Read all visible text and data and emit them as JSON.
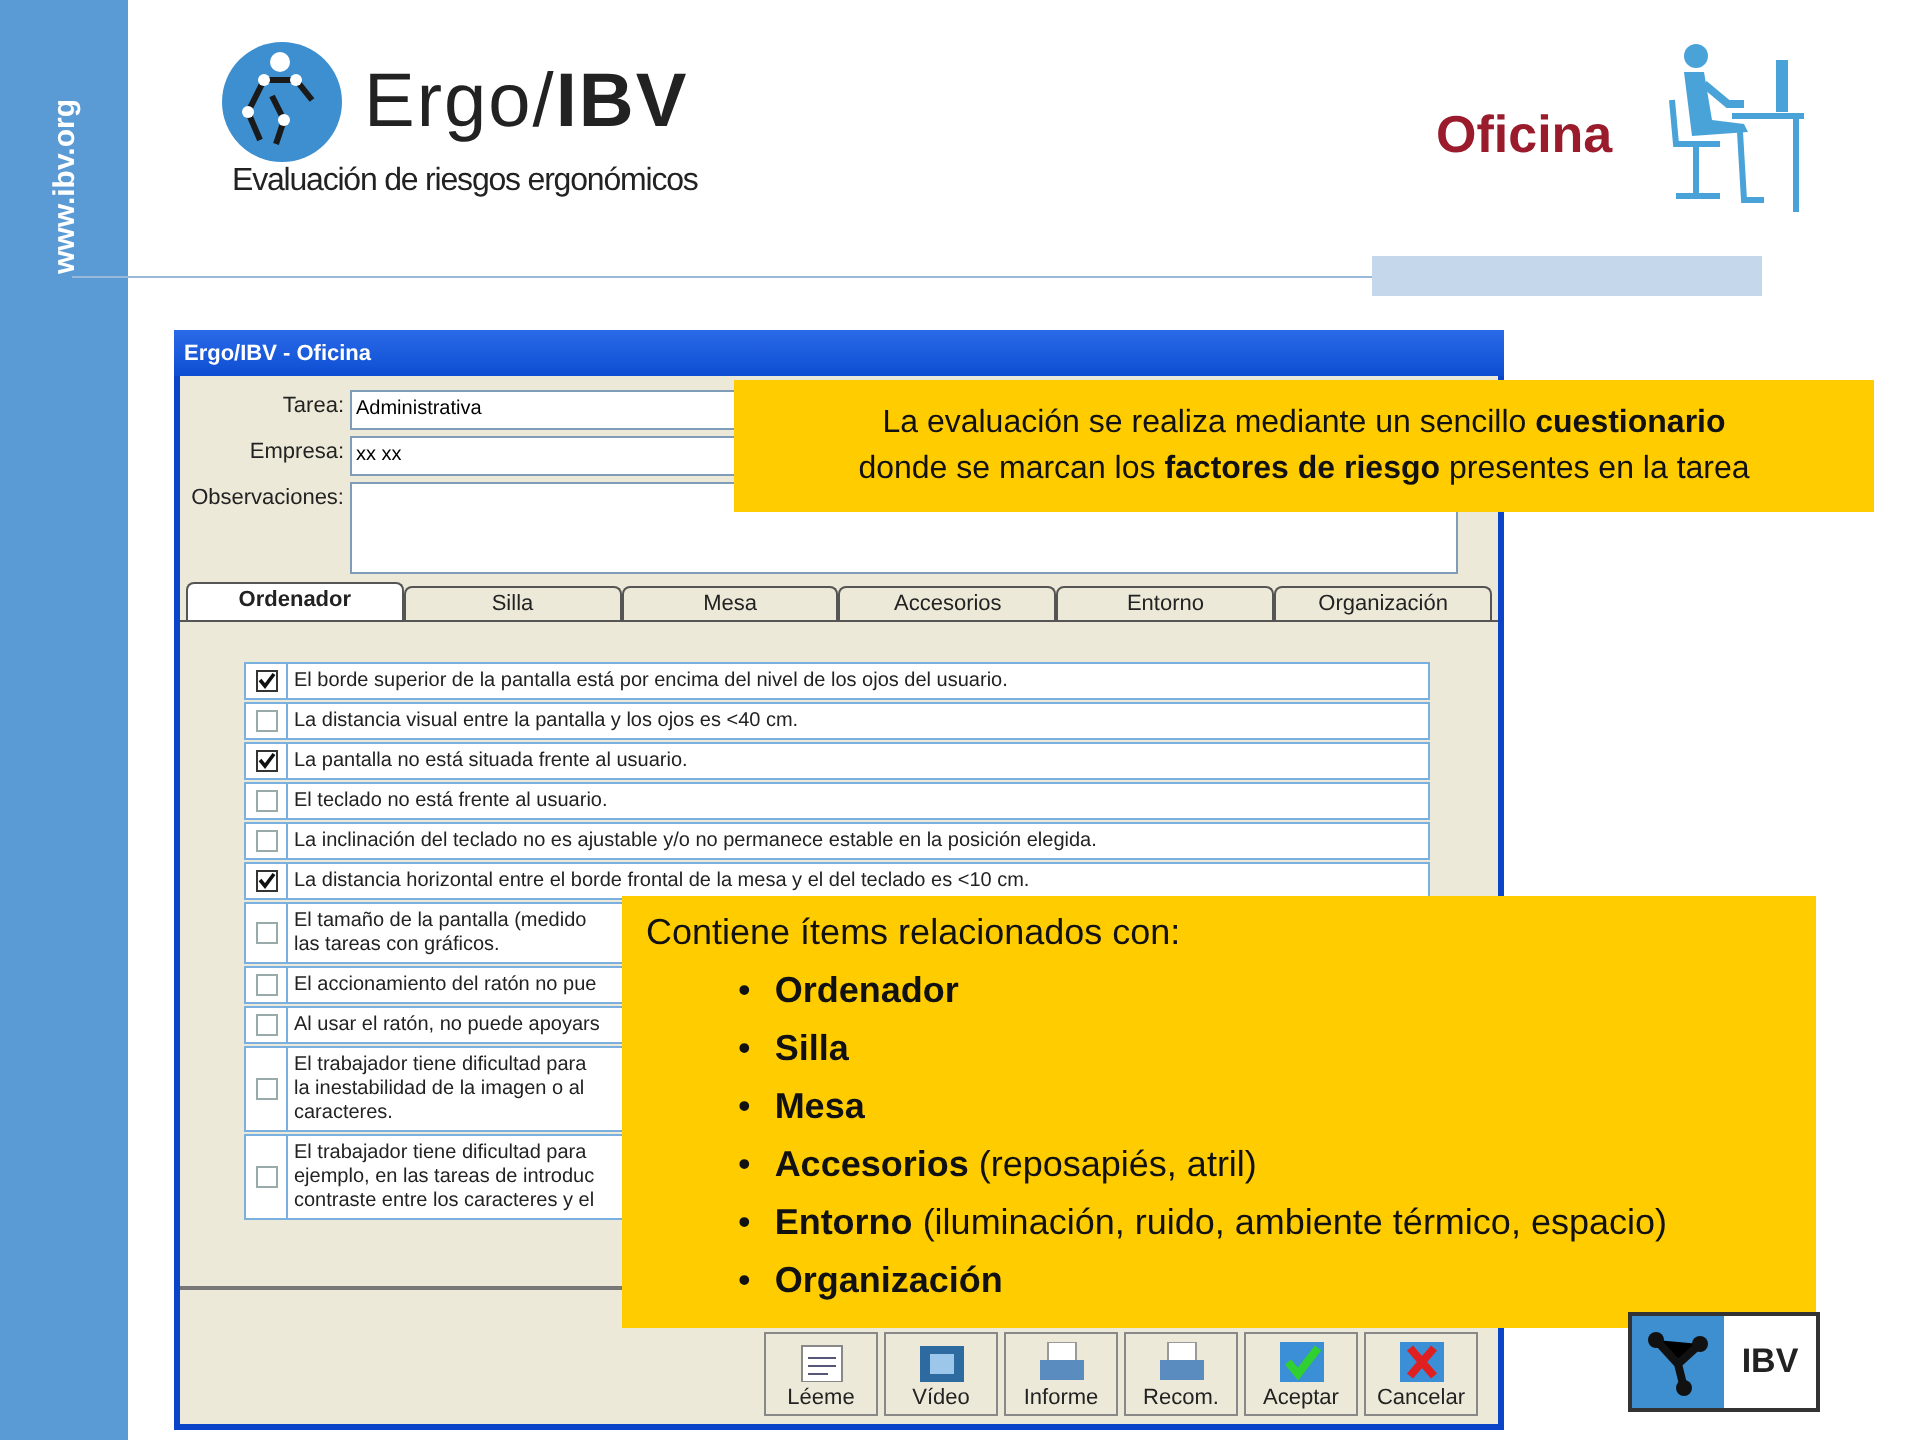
{
  "sidebar": {
    "text": "www.ibv.org"
  },
  "header": {
    "wordmark": "Ergo/**IBV**",
    "tagline": "Evaluación de riesgos ergonómicos",
    "section": "Oficina"
  },
  "window": {
    "title": "Ergo/IBV - Oficina",
    "fields": [
      {
        "label": "Tarea:",
        "value": "Administrativa",
        "kind": "line"
      },
      {
        "label": "Empresa:",
        "value": "xx xx",
        "kind": "line"
      },
      {
        "label": "Observaciones:",
        "kind": "multiline"
      }
    ],
    "tabs": [
      {
        "label": "Ordenador",
        "selected": true
      },
      {
        "label": "Silla",
        "selected": false
      },
      {
        "label": "Mesa",
        "selected": false
      },
      {
        "label": "Accesorios",
        "selected": false
      },
      {
        "label": "Entorno",
        "selected": false
      },
      {
        "label": "Organización",
        "selected": false
      }
    ],
    "items": [
      {
        "checked": true,
        "lines": [
          "El borde superior de la pantalla está por encima del nivel de los ojos del usuario."
        ]
      },
      {
        "checked": false,
        "lines": [
          "La distancia visual entre la pantalla y los ojos es <40 cm."
        ]
      },
      {
        "checked": true,
        "lines": [
          "La pantalla no está situada frente al usuario."
        ]
      },
      {
        "checked": false,
        "lines": [
          "El teclado no está frente al usuario."
        ]
      },
      {
        "checked": false,
        "lines": [
          "La inclinación del teclado no es ajustable y/o no permanece estable en la posición elegida."
        ]
      },
      {
        "checked": true,
        "lines": [
          "La distancia horizontal entre el borde frontal de la mesa y el del teclado es <10 cm."
        ]
      },
      {
        "checked": false,
        "lines": [
          "El tamaño de la pantalla (medido",
          "las tareas con gráficos."
        ]
      },
      {
        "checked": false,
        "lines": [
          "El accionamiento del ratón no pue"
        ]
      },
      {
        "checked": false,
        "lines": [
          "Al usar el ratón, no puede apoyars"
        ]
      },
      {
        "checked": false,
        "lines": [
          "El trabajador tiene dificultad para",
          "la inestabilidad de la imagen o al",
          "caracteres."
        ]
      },
      {
        "checked": false,
        "lines": [
          "El trabajador tiene dificultad para",
          "ejemplo, en las tareas de introduc",
          "contraste entre los caracteres y el"
        ]
      }
    ],
    "buttons": [
      {
        "label": "Léeme",
        "kind": "readme"
      },
      {
        "label": "Vídeo",
        "kind": "video"
      },
      {
        "label": "Informe",
        "kind": "report"
      },
      {
        "label": "Recom.",
        "kind": "report"
      },
      {
        "label": "Aceptar",
        "kind": "accept"
      },
      {
        "label": "Cancelar",
        "kind": "cancel"
      }
    ]
  },
  "callouts": [
    {
      "lines": [
        "La evaluación se realiza mediante un sencillo **cuestionario**",
        "donde se marcan los **factores de riesgo** presentes en la tarea"
      ]
    },
    {
      "intro": "Contiene ítems relacionados con:",
      "marker": "•",
      "bullets": [
        "**Ordenador**",
        "**Silla**",
        "**Mesa**",
        "**Accesorios** (reposapiés, atril)",
        "**Entorno** (iluminación, ruido, ambiente térmico, espacio)",
        "**Organización**"
      ]
    }
  ],
  "footer_logo": {
    "text": "IBV"
  }
}
